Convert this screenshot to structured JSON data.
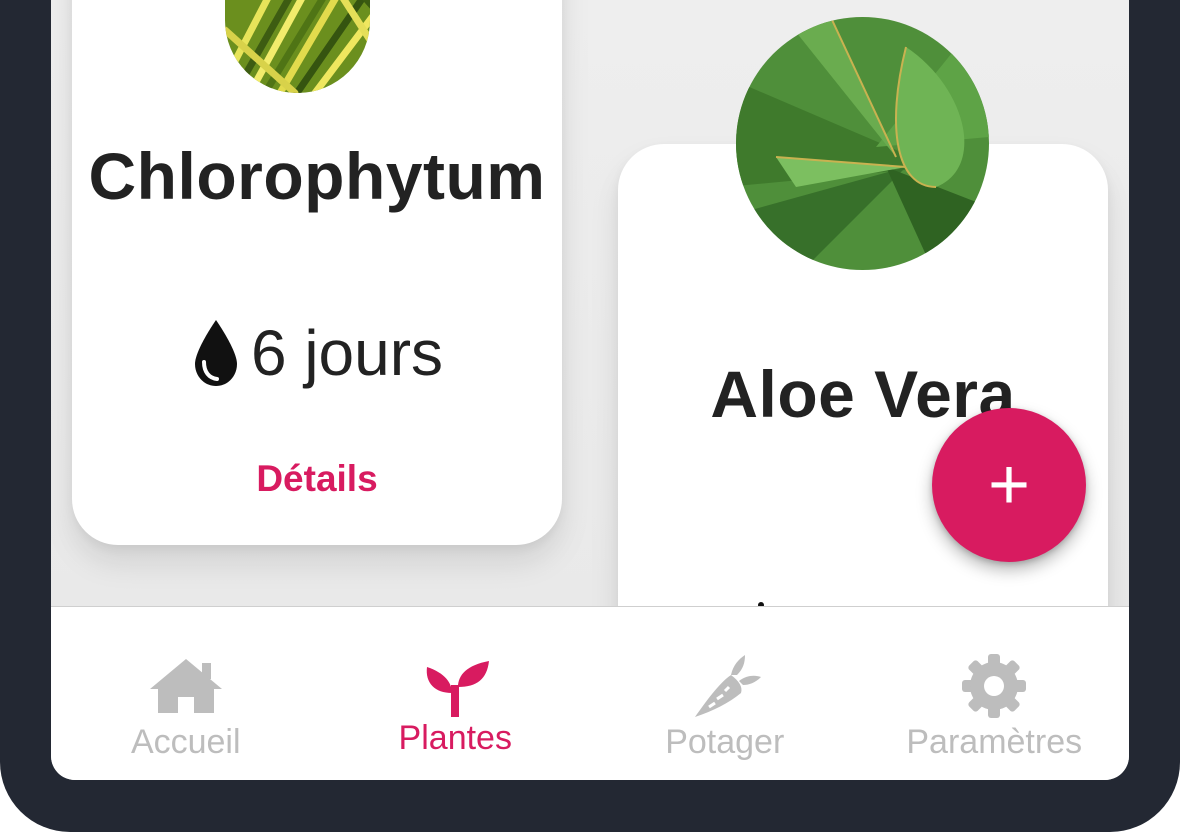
{
  "plants": [
    {
      "name": "Chlorophytum",
      "water_interval": "6 jours",
      "details_label": "Détails"
    },
    {
      "name": "Aloe Vera"
    }
  ],
  "fab": {
    "label": "+"
  },
  "nav": {
    "items": [
      {
        "label": "Accueil",
        "icon": "home-icon",
        "active": false
      },
      {
        "label": "Plantes",
        "icon": "sprout-icon",
        "active": true
      },
      {
        "label": "Potager",
        "icon": "carrot-icon",
        "active": false
      },
      {
        "label": "Paramètres",
        "icon": "gear-icon",
        "active": false
      }
    ]
  },
  "colors": {
    "accent": "#d81b60",
    "inactive": "#bdbdbd",
    "text": "#222222",
    "frame": "#232833"
  }
}
